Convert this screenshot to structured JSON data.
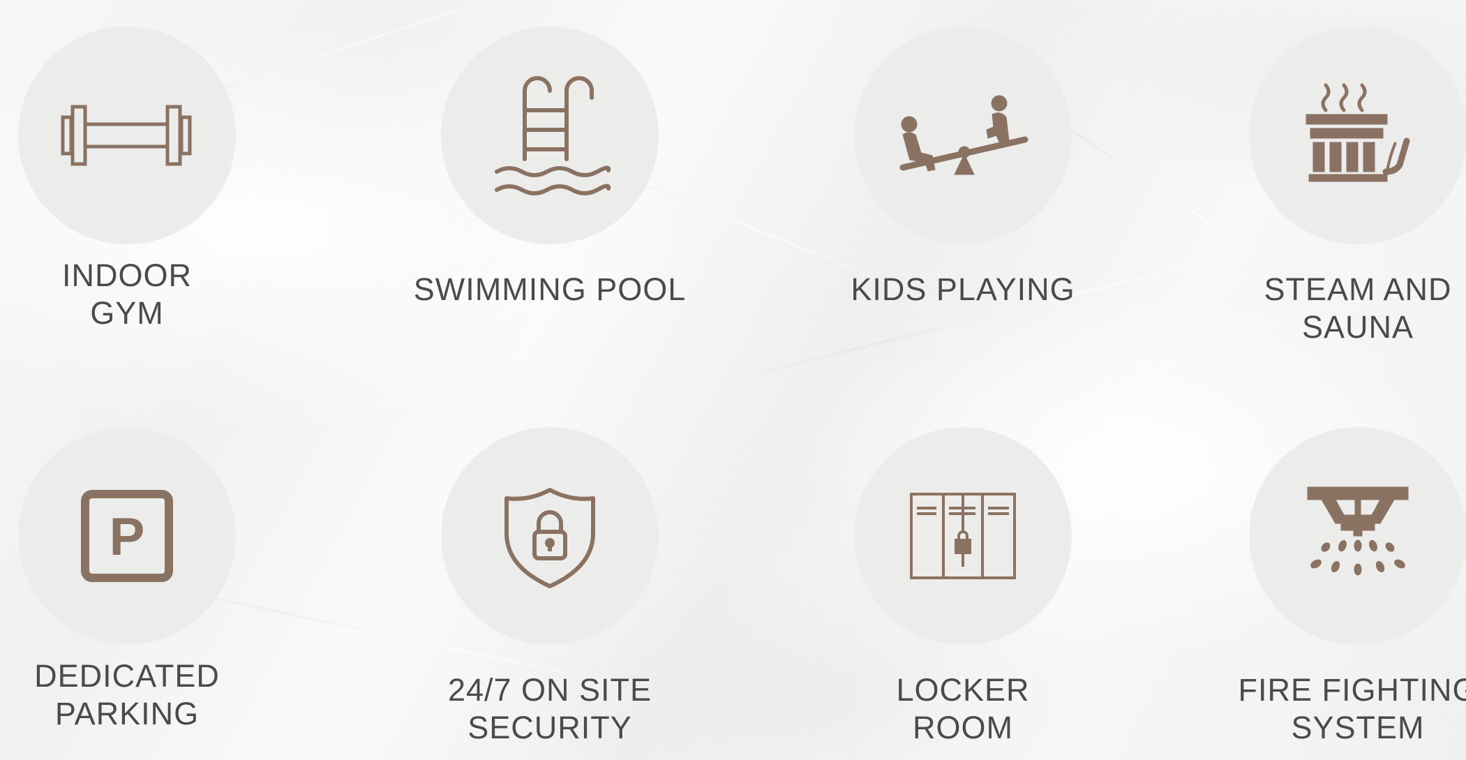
{
  "amenities": [
    {
      "name": "indoor-gym",
      "icon": "dumbbell-icon",
      "label_lines": [
        "INDOOR",
        "GYM"
      ]
    },
    {
      "name": "swimming-pool",
      "icon": "pool-ladder-icon",
      "label_lines": [
        "SWIMMING POOL"
      ]
    },
    {
      "name": "kids-playing",
      "icon": "seesaw-icon",
      "label_lines": [
        "KIDS PLAYING"
      ]
    },
    {
      "name": "steam-and-sauna",
      "icon": "sauna-bucket-icon",
      "label_lines": [
        "STEAM AND",
        "SAUNA"
      ]
    },
    {
      "name": "dedicated-parking",
      "icon": "parking-icon",
      "label_lines": [
        "DEDICATED",
        "PARKING"
      ]
    },
    {
      "name": "on-site-security",
      "icon": "shield-lock-icon",
      "label_lines": [
        "24/7 ON SITE",
        "SECURITY"
      ]
    },
    {
      "name": "locker-room",
      "icon": "locker-icon",
      "label_lines": [
        "LOCKER",
        "ROOM"
      ]
    },
    {
      "name": "fire-fighting-system",
      "icon": "sprinkler-icon",
      "label_lines": [
        "FIRE FIGHTING",
        "SYSTEM"
      ]
    }
  ],
  "colors": {
    "icon": "#8a7262",
    "circle": "#ececeb",
    "text": "#4a4a4a"
  }
}
